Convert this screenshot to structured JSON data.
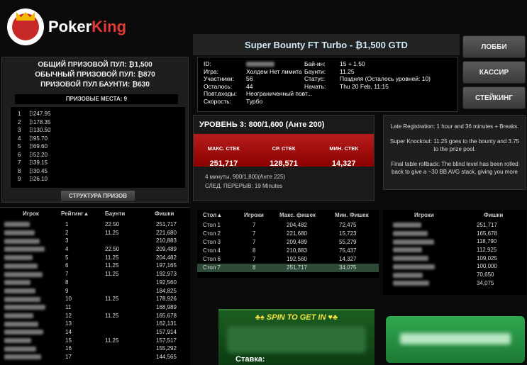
{
  "brand": {
    "name_a": "Poker",
    "name_b": "King"
  },
  "nav": {
    "lobby": "ЛОББИ",
    "cashier": "КАССИР",
    "staking": "СТЕЙКИНГ"
  },
  "tournament": {
    "title": "Super Bounty FT Turbo - ₿1,500 GTD"
  },
  "info_left": [
    {
      "k": "ID:",
      "v": ""
    },
    {
      "k": "Игра:",
      "v": "Холдем Нет лимита"
    },
    {
      "k": "Участники:",
      "v": "56"
    },
    {
      "k": "Осталось:",
      "v": "44"
    },
    {
      "k": "Повт.входы:",
      "v": "Неограниченный повт..."
    },
    {
      "k": "Скорость:",
      "v": "Турбо"
    }
  ],
  "info_right": [
    {
      "k": "Бай-ин:",
      "v": "15 + 1.50"
    },
    {
      "k": "Баунти:",
      "v": "11.25"
    },
    {
      "k": "Статус:",
      "v": "Поздняя (Осталось уровней: 10)"
    },
    {
      "k": "Начать:",
      "v": "Thu 20 Feb, 11:15"
    }
  ],
  "prize": {
    "total": "ОБЩИЙ ПРИЗОВОЙ ПУЛ: ₿1,500",
    "regular": "ОБЫЧНЫЙ ПРИЗОВОЙ ПУЛ: ₿870",
    "bounty": "ПРИЗОВОЙ ПУЛ БАУНТИ: ₿630",
    "places_title": "ПРИЗОВЫЕ МЕСТА: 9",
    "structure_btn": "СТРУКТУРА ПРИЗОВ",
    "places": [
      {
        "n": "1",
        "v": "247.95"
      },
      {
        "n": "2",
        "v": "178.35"
      },
      {
        "n": "3",
        "v": "130.50"
      },
      {
        "n": "4",
        "v": "95.70"
      },
      {
        "n": "5",
        "v": "69.60"
      },
      {
        "n": "6",
        "v": "52.20"
      },
      {
        "n": "7",
        "v": "39.15"
      },
      {
        "n": "8",
        "v": "30.45"
      },
      {
        "n": "9",
        "v": "26.10"
      }
    ]
  },
  "level": {
    "title": "УРОВЕНЬ 3: 800/1,600 (Анте 200)",
    "max_label": "МАКС. СТЕК",
    "max": "251,717",
    "avg_label": "СР. СТЕК",
    "avg": "128,571",
    "min_label": "МИН. СТЕК",
    "min": "14,327",
    "next": "4 минуты, 900/1,800(Анте 225)",
    "break": "СЛЕД. ПЕРЕРЫВ: 19 Minutes"
  },
  "notes": [
    "Late Registration: 1 hour and 36 minutes + Breaks.",
    "Super Knockout: 11.25 goes to the bounty and 3.75 to the prize pool.",
    "Final table rollback: The blind level has been rolled back to give a ~30 BB AVG stack, giving you more"
  ],
  "players": {
    "headers": {
      "player": "Игрок",
      "rank": "Рейтинг▲",
      "bounty": "Баунти",
      "chips": "Фишки"
    },
    "rows": [
      {
        "r": "1",
        "b": "22.50",
        "c": "251,717"
      },
      {
        "r": "2",
        "b": "11.25",
        "c": "221,680"
      },
      {
        "r": "3",
        "b": "",
        "c": "210,883"
      },
      {
        "r": "4",
        "b": "22.50",
        "c": "209,489"
      },
      {
        "r": "5",
        "b": "11.25",
        "c": "204,482"
      },
      {
        "r": "6",
        "b": "11.25",
        "c": "197,165"
      },
      {
        "r": "7",
        "b": "11.25",
        "c": "192,973"
      },
      {
        "r": "8",
        "b": "",
        "c": "192,560"
      },
      {
        "r": "9",
        "b": "",
        "c": "184,825"
      },
      {
        "r": "10",
        "b": "11.25",
        "c": "178,926"
      },
      {
        "r": "11",
        "b": "",
        "c": "168,989"
      },
      {
        "r": "12",
        "b": "11.25",
        "c": "165,678"
      },
      {
        "r": "13",
        "b": "",
        "c": "162,131"
      },
      {
        "r": "14",
        "b": "",
        "c": "157,914"
      },
      {
        "r": "15",
        "b": "11.25",
        "c": "157,517"
      },
      {
        "r": "16",
        "b": "",
        "c": "155,292"
      },
      {
        "r": "17",
        "b": "",
        "c": "144,565"
      }
    ]
  },
  "tables": {
    "headers": {
      "table": "Стол▲",
      "players": "Игроки",
      "max": "Макс. фишек",
      "min": "Мин. Фишек"
    },
    "rows": [
      {
        "t": "Стол 1",
        "p": "7",
        "mx": "204,482",
        "mn": "72,475"
      },
      {
        "t": "Стол 2",
        "p": "7",
        "mx": "221,680",
        "mn": "15,723"
      },
      {
        "t": "Стол 3",
        "p": "7",
        "mx": "209,489",
        "mn": "55,279"
      },
      {
        "t": "Стол 4",
        "p": "8",
        "mx": "210,883",
        "mn": "75,437"
      },
      {
        "t": "Стол 6",
        "p": "7",
        "mx": "192,560",
        "mn": "14,327"
      },
      {
        "t": "Стол 7",
        "p": "8",
        "mx": "251,717",
        "mn": "34,075"
      }
    ]
  },
  "table_players": {
    "headers": {
      "player": "Игроки",
      "chips": "Фишки"
    },
    "rows": [
      "251,717",
      "165,678",
      "118,790",
      "112,925",
      "109,025",
      "100,000",
      "70,650",
      "34,075"
    ]
  },
  "spin": {
    "title": "SPIN TO GET IN",
    "bet": "Ставка:"
  }
}
